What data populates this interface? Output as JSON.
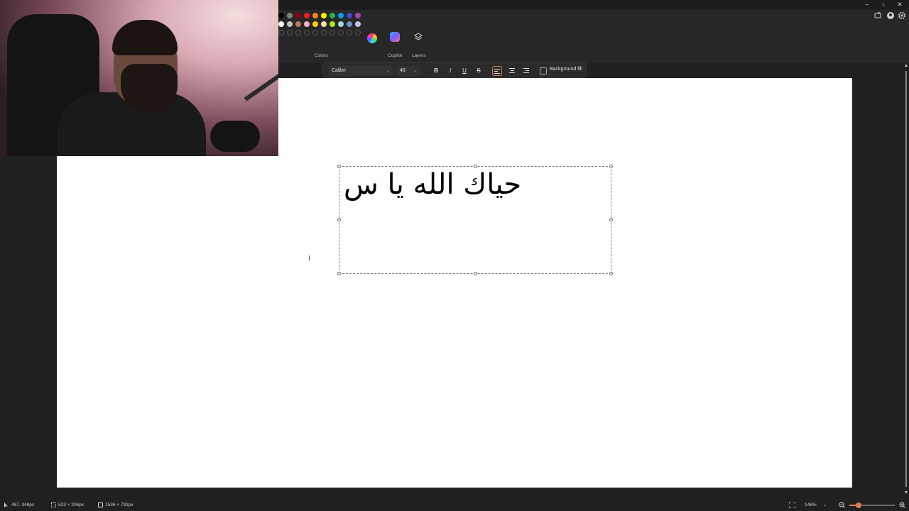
{
  "window": {
    "minimize": "–",
    "maximize": "▫",
    "close": "✕"
  },
  "ribbon": {
    "colors_label": "Colors",
    "copilot_label": "Copilot",
    "layers_label": "Layers",
    "palette_row1": [
      "#000000",
      "#7f7f7f",
      "#880015",
      "#ed1c24",
      "#ff7f27",
      "#fff200",
      "#22b14c",
      "#00a2e8",
      "#3f48cc",
      "#a349a4"
    ],
    "palette_row2": [
      "#ffffff",
      "#c3c3c3",
      "#b97a57",
      "#ffaec9",
      "#ffc90e",
      "#efe4b0",
      "#b5e61d",
      "#99d9ea",
      "#7092be",
      "#c8bfe7"
    ]
  },
  "text_toolbar": {
    "font": "Calibri",
    "size": "48",
    "bold": "B",
    "italic": "I",
    "underline": "U",
    "strikethrough": "S",
    "background_fill_label": "Background fill"
  },
  "canvas": {
    "text": "حياك الله يا س"
  },
  "status": {
    "cursor_pos": "487, 348px",
    "selection_size": "523 × 206px",
    "canvas_size": "1536 × 791px",
    "zoom": "146%",
    "zoom_level": 0.2
  }
}
